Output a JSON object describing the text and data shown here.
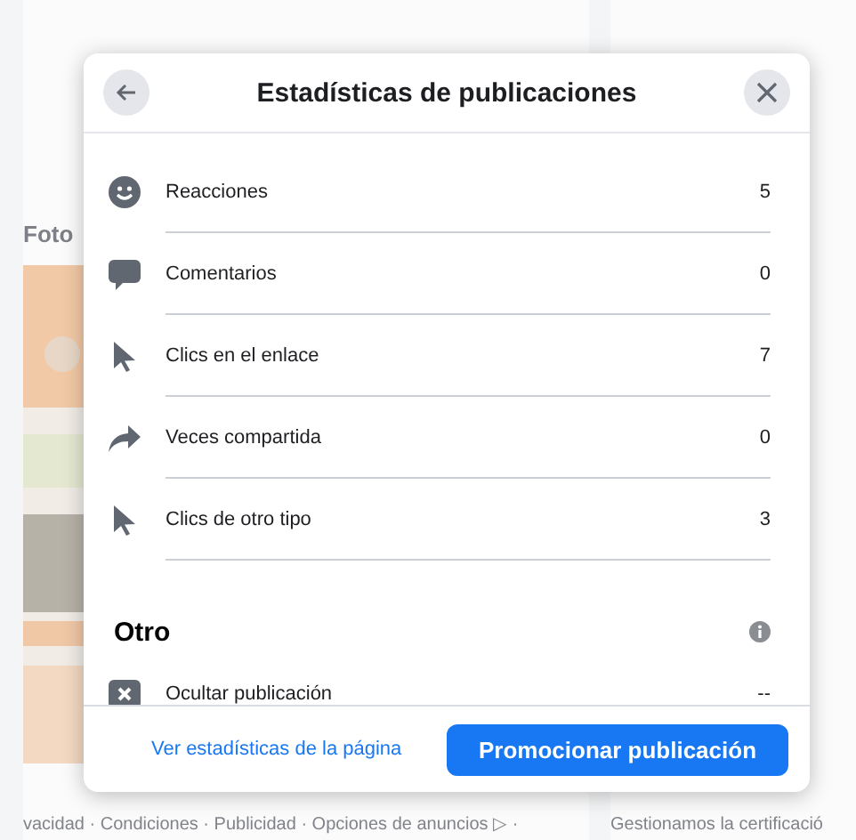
{
  "background": {
    "section_title": "Foto",
    "footer_links": "vacidad · Condiciones · Publicidad · Opciones de anuncios ▷ ·",
    "post_preview": "Gestionamos la certificació"
  },
  "dialog": {
    "title": "Estadísticas de publicaciones",
    "stats": [
      {
        "kind": "smiley",
        "label": "Reacciones",
        "value": "5"
      },
      {
        "kind": "speech",
        "label": "Comentarios",
        "value": "0"
      },
      {
        "kind": "pointer",
        "label": "Clics en el enlace",
        "value": "7"
      },
      {
        "kind": "share",
        "label": "Veces compartida",
        "value": "0"
      },
      {
        "kind": "pointer",
        "label": "Clics de otro tipo",
        "value": "3"
      }
    ],
    "other_section": {
      "title": "Otro",
      "items": [
        {
          "kind": "hide",
          "label": "Ocultar publicación",
          "value": "--"
        }
      ]
    },
    "footer": {
      "link": "Ver estadísticas de la página",
      "button": "Promocionar publicación"
    }
  }
}
